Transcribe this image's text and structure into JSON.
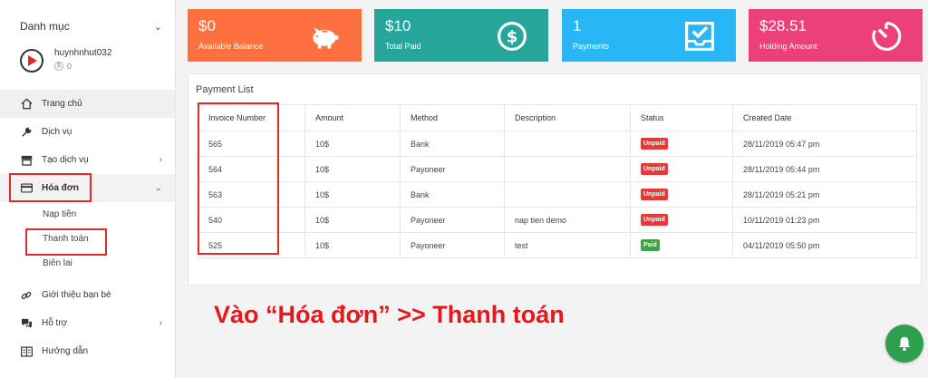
{
  "sidebar": {
    "header": "Danh mục",
    "user": {
      "name": "huynhnhut032",
      "balance": "0"
    },
    "menu": [
      {
        "label": "Trang chủ",
        "icon": "home-icon"
      },
      {
        "label": "Dịch vụ",
        "icon": "wrench-icon"
      },
      {
        "label": "Tạo dịch vụ",
        "icon": "store-icon"
      },
      {
        "label": "Hóa đơn",
        "icon": "card-icon"
      },
      {
        "label": "Nạp tiền"
      },
      {
        "label": "Thanh toán"
      },
      {
        "label": "Biên lai"
      },
      {
        "label": "Giới thiệu bạn bè",
        "icon": "link-icon"
      },
      {
        "label": "Hỗ trợ",
        "icon": "chat-icon"
      },
      {
        "label": "Hướng dẫn",
        "icon": "book-icon"
      }
    ]
  },
  "stats": [
    {
      "value": "$0",
      "label": "Available Balance",
      "color": "#fe7040",
      "icon": "piggy-bank-icon"
    },
    {
      "value": "$10",
      "label": "Total Paid",
      "color": "#26a69a",
      "icon": "dollar-circle-icon"
    },
    {
      "value": "1",
      "label": "Payments",
      "color": "#29b6f6",
      "icon": "inbox-check-icon"
    },
    {
      "value": "$28.51",
      "label": "Holding Amount",
      "color": "#ec407a",
      "icon": "timer-icon"
    }
  ],
  "payments": {
    "title": "Payment List",
    "columns": [
      "Invoice Number",
      "Amount",
      "Method",
      "Description",
      "Status",
      "Created Date"
    ],
    "rows": [
      {
        "invoice": "565",
        "amount": "10$",
        "method": "Bank",
        "description": "",
        "status": "Unpaid",
        "date": "28/11/2019 05:47 pm"
      },
      {
        "invoice": "564",
        "amount": "10$",
        "method": "Payoneer",
        "description": "",
        "status": "Unpaid",
        "date": "28/11/2019 05:44 pm"
      },
      {
        "invoice": "563",
        "amount": "10$",
        "method": "Bank",
        "description": "",
        "status": "Unpaid",
        "date": "28/11/2019 05:21 pm"
      },
      {
        "invoice": "540",
        "amount": "10$",
        "method": "Payoneer",
        "description": "nap tien demo",
        "status": "Unpaid",
        "date": "10/11/2019 01:23 pm"
      },
      {
        "invoice": "525",
        "amount": "10$",
        "method": "Payoneer",
        "description": "test",
        "status": "Paid",
        "date": "04/11/2019 05:50 pm"
      }
    ]
  },
  "instruction": "Vào “Hóa đơn” >> Thanh toán",
  "colors": {
    "annotation": "#e3191b",
    "unpaid": "#e53935",
    "paid": "#43a047",
    "bell": "#2e9e4f"
  }
}
